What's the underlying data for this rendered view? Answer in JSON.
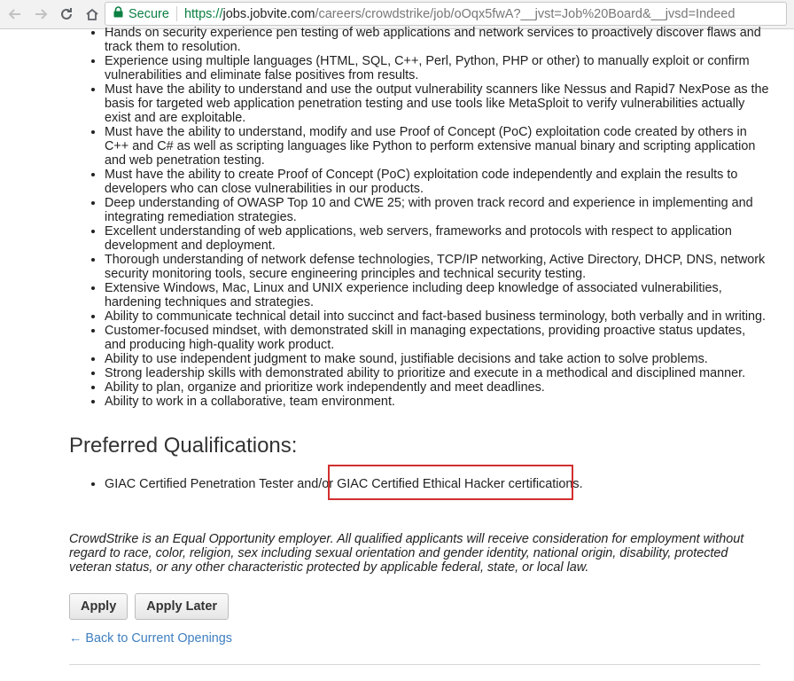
{
  "browser": {
    "secure_label": "Secure",
    "url_scheme": "https://",
    "url_host": "jobs.jobvite.com",
    "url_path": "/careers/crowdstrike/job/oOqx5fwA?__jvst=Job%20Board&__jvsd=Indeed",
    "icons": [
      "back-arrow-icon",
      "forward-arrow-icon",
      "reload-icon",
      "home-icon",
      "lock-icon"
    ]
  },
  "requirements": [
    "Hands on security experience pen testing of web applications and network services to proactively discover flaws and track them to resolution.",
    "Experience using multiple languages (HTML, SQL, C++, Perl, Python, PHP or other) to manually exploit or confirm vulnerabilities and eliminate false positives from results.",
    "Must have the ability to understand and use the output vulnerability scanners like Nessus and Rapid7 NexPose as the basis for targeted web application penetration testing and use tools like MetaSploit to verify vulnerabilities actually exist and are exploitable.",
    "Must have the ability to understand, modify and use Proof of Concept (PoC) exploitation code created by others in C++ and C# as well as scripting languages like Python to perform extensive manual binary and scripting application and web penetration testing.",
    "Must have the ability to create Proof of Concept (PoC) exploitation code independently and explain the results to developers who can close vulnerabilities in our products.",
    "Deep understanding of OWASP Top 10 and CWE 25; with proven track record and experience in implementing and integrating remediation strategies.",
    "Excellent understanding of web applications, web servers, frameworks and protocols with respect to application development and deployment.",
    "Thorough understanding of network defense technologies, TCP/IP networking, Active Directory, DHCP, DNS, network security monitoring tools, secure engineering principles and technical security testing.",
    "Extensive Windows, Mac, Linux and UNIX experience including deep knowledge of associated vulnerabilities, hardening techniques and strategies.",
    "Ability to communicate technical detail into succinct and fact-based business terminology, both verbally and in writing.",
    "Customer-focused mindset, with demonstrated skill in managing expectations, providing proactive status updates, and producing high-quality work product.",
    "Ability to use independent judgment to make sound, justifiable decisions and take action to solve problems.",
    "Strong leadership skills with demonstrated ability to prioritize and execute in a methodical and disciplined manner.",
    "Ability to plan, organize and prioritize work independently and meet deadlines.",
    "Ability to work in a collaborative, team environment."
  ],
  "preferred": {
    "heading": "Preferred Qualifications:",
    "items": [
      "GIAC Certified Penetration Tester and/or GIAC Certified Ethical Hacker certifications."
    ]
  },
  "eeo_statement": "CrowdStrike is an Equal Opportunity employer.  All qualified applicants will receive consideration for employment without regard to race, color, religion, sex including sexual orientation and gender identity, national origin, disability, protected veteran status, or any other characteristic protected by applicable federal, state, or local law.",
  "actions": {
    "apply_label": "Apply",
    "apply_later_label": "Apply Later",
    "back_link": "← Back to Current Openings"
  },
  "colors": {
    "secure_green": "#0b8043",
    "link_blue": "#3e7fc1",
    "highlight_red": "#d32f2f"
  }
}
